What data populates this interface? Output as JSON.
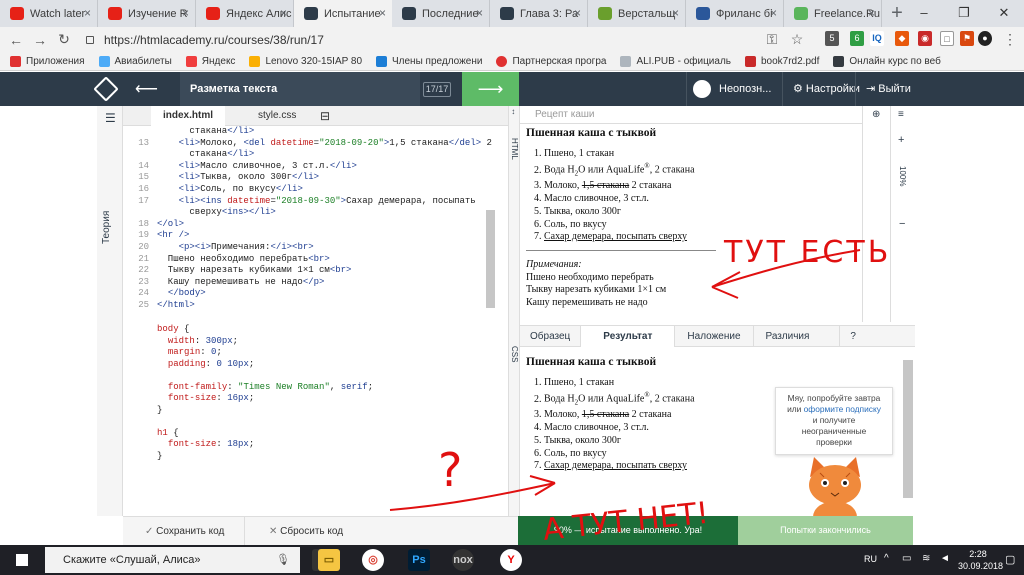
{
  "browser": {
    "tabs": [
      {
        "label": "Watch later",
        "color": "#e62117"
      },
      {
        "label": "Изучение R",
        "color": "#e62117"
      },
      {
        "label": "Яндекс Алис",
        "color": "#e62117"
      },
      {
        "label": "Испытание",
        "color": "#2d3b49"
      },
      {
        "label": "Последние",
        "color": "#2d3b49"
      },
      {
        "label": "Глава 3: Ра",
        "color": "#2d3b49"
      },
      {
        "label": "Верстальщ",
        "color": "#6a9f2d"
      },
      {
        "label": "Фриланс бі",
        "color": "#2b579a"
      },
      {
        "label": "Freelance.Ru",
        "color": "#5ab55c"
      }
    ],
    "url": "https://htmlacademy.ru/courses/38/run/17",
    "bookmarks": [
      "Приложения",
      "Авиабилеты",
      "Яндекс",
      "Lenovo 320-15IAP 80",
      "Члены предложени",
      "Партнерская програ",
      "ALI.PUB - официаль",
      "book7rd2.pdf",
      "Онлайн курс по веб"
    ]
  },
  "header": {
    "lesson_title": "Разметка текста",
    "counter": "17/17",
    "user": "Неопозн...",
    "settings": "Настройки",
    "logout": "Выйти"
  },
  "sidebar": {
    "theory": "Теория"
  },
  "editor": {
    "tabs": {
      "html": "index.html",
      "css": "style.css"
    },
    "side_html": "HTML",
    "side_css": "CSS"
  },
  "preview": {
    "header": "Рецепт каши",
    "zoom": "100%",
    "title": "Пшенная каша с тыквой",
    "items": [
      "Пшено, 1 стакан",
      "Вода H",
      "2",
      "O или AquaLife",
      "®",
      ", 2 стакана",
      "Молоко, ",
      "1,5 стакана",
      " 2 стакана",
      "Масло сливочное, 3 ст.л.",
      "Тыква, около 300г",
      "Соль, по вкусу",
      "Сахар демерара, посыпать сверху"
    ],
    "note_label": "Примечания:",
    "note_lines": [
      "Пшено необходимо перебрать",
      "Тыкву нарезать кубиками 1×1 см",
      "Кашу перемешивать не надо"
    ]
  },
  "result_tabs": [
    "Образец",
    "Результат",
    "Наложение",
    "Различия",
    "?"
  ],
  "tooltip": {
    "line1": "Мяу, попробуйте завтра",
    "line2": "или",
    "link": "оформите подписку",
    "line3": "и получите",
    "line4": "неограниченные",
    "line5": "проверки"
  },
  "bottom": {
    "save": "Сохранить код",
    "reset": "Сбросить код",
    "progress": "90% — испытание выполнено. Ура!",
    "attempts": "Попытки закончились"
  },
  "annotations": {
    "here": "ТУТ ЕСТЬ",
    "missing": "А ТУТ НЕТ!",
    "question": "?"
  },
  "taskbar": {
    "search": "Скажите «Слушай, Алиса»",
    "lang": "RU",
    "time": "2:28",
    "date": "30.09.2018"
  }
}
